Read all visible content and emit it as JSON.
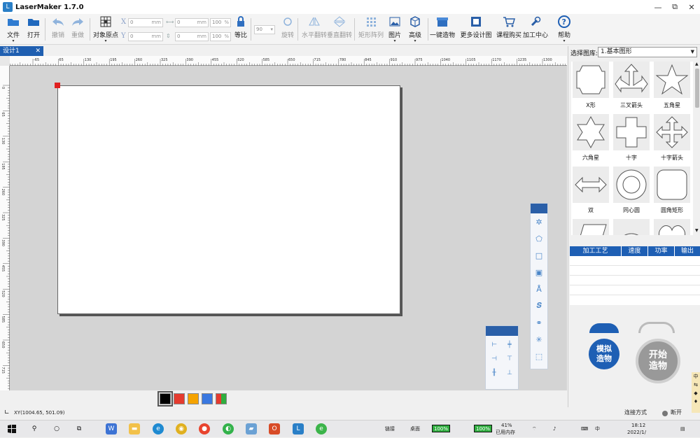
{
  "app": {
    "title": "LaserMaker 1.7.0",
    "logo": "L"
  },
  "window": {
    "min": "—",
    "restore": "⧉",
    "close": "✕"
  },
  "toolbar": {
    "file": "文件",
    "open": "打开",
    "undo": "撤销",
    "redo": "重做",
    "origin": "对象原点",
    "ratio": "等比",
    "rotate": "旋转",
    "hflip": "水平翻转",
    "vflip": "垂直翻转",
    "array": "矩形阵列",
    "image": "图片",
    "advanced": "高级",
    "onekey": "一键造物",
    "more_designs": "更多设计图",
    "buy_course": "课程购买",
    "process_center": "加工中心",
    "help": "帮助"
  },
  "fields": {
    "x_label": "X",
    "y_label": "Y",
    "x_value": "0",
    "y_value": "0",
    "w_value": "0",
    "h_value": "0",
    "unit_mm": "mm",
    "scale_w": "100",
    "scale_h": "100",
    "unit_pct": "%",
    "rotate_value": "90"
  },
  "tab": {
    "name": "设计1",
    "close": "✕"
  },
  "ruler": {
    "h_ticks": [
      "-65",
      "65",
      "130",
      "195",
      "260",
      "325",
      "390",
      "455",
      "520",
      "585",
      "650",
      "715",
      "780",
      "845",
      "910",
      "975",
      "1040",
      "1105",
      "1170",
      "1235",
      "1300"
    ],
    "v_ticks": [
      "0",
      "65",
      "130",
      "195",
      "260",
      "325",
      "390",
      "455",
      "520",
      "585",
      "650",
      "715",
      "780"
    ]
  },
  "colors": {
    "accent": "#1e5fb4",
    "swatches": [
      "#000000",
      "#e53b2f",
      "#f5a300",
      "#3a78e0",
      "mix"
    ]
  },
  "status": {
    "coords": "XY(1004.65, 501.09)",
    "connect_mode": "连接方式",
    "disconnected": "断开"
  },
  "library": {
    "label": "选择图库:",
    "selected": "1.基本图形",
    "shapes": [
      "X形",
      "三叉箭头",
      "五角星",
      "六角星",
      "十字",
      "十字箭头",
      "双",
      "同心圆",
      "圆角矩形"
    ]
  },
  "process_table": {
    "headers": [
      "加工工艺",
      "速度",
      "功率",
      "输出"
    ]
  },
  "buttons": {
    "simulate": "模拟\n造物",
    "start": "开始\n造物"
  },
  "side_tab": [
    "中",
    "⇆"
  ],
  "taskbar": {
    "link": "链接",
    "desktop": "桌面",
    "battery1": "100%",
    "battery2": "100%",
    "mem_pct": "41%",
    "mem_label": "已用内存",
    "ime": "中",
    "time": "18:12",
    "date": "2022/1/"
  }
}
